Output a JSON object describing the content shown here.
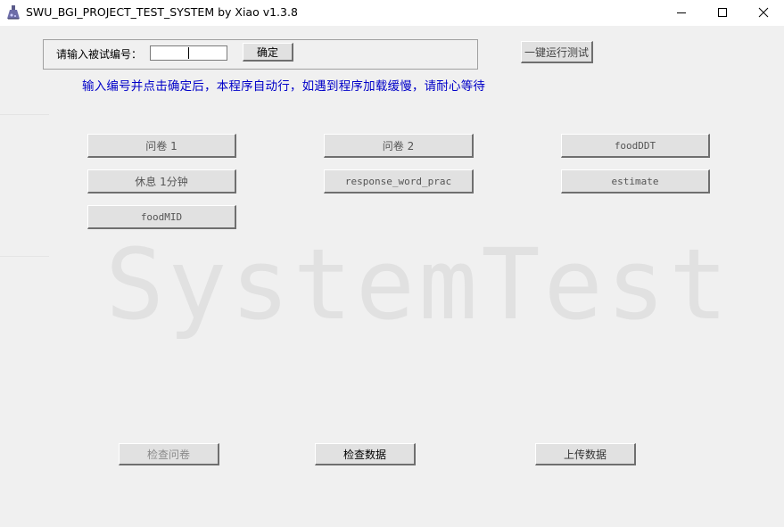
{
  "window": {
    "title": "SWU_BGI_PROJECT_TEST_SYSTEM by Xiao v1.3.8",
    "icons": {
      "app": "app-flask-icon",
      "minimize": "minimize-icon",
      "maximize": "maximize-icon",
      "close": "close-icon"
    }
  },
  "form": {
    "prompt_label": "请输入被试编号：",
    "subject_id_value": "",
    "confirm_label": "确定",
    "run_all_label": "一键运行测试",
    "hint": "输入编号并点击确定后，本程序自动行，如遇到程序加载缓慢，请耐心等待"
  },
  "tests": [
    {
      "id": "questionnaire-1",
      "label": "问卷 1"
    },
    {
      "id": "questionnaire-2",
      "label": "问卷 2"
    },
    {
      "id": "food-ddt",
      "label": "foodDDT"
    },
    {
      "id": "rest-1min",
      "label": "休息 1分钟"
    },
    {
      "id": "response-word-prac",
      "label": "response_word_prac"
    },
    {
      "id": "estimate",
      "label": "estimate"
    },
    {
      "id": "food-mid",
      "label": "foodMID"
    }
  ],
  "footer": {
    "check_questionnaire_label": "检查问卷",
    "check_data_label": "检查数据",
    "upload_data_label": "上传数据"
  },
  "watermark": "SystemTest",
  "colors": {
    "hint_text": "#0000c8",
    "background": "#f0f0f0",
    "watermark": "#e1e1e1"
  }
}
